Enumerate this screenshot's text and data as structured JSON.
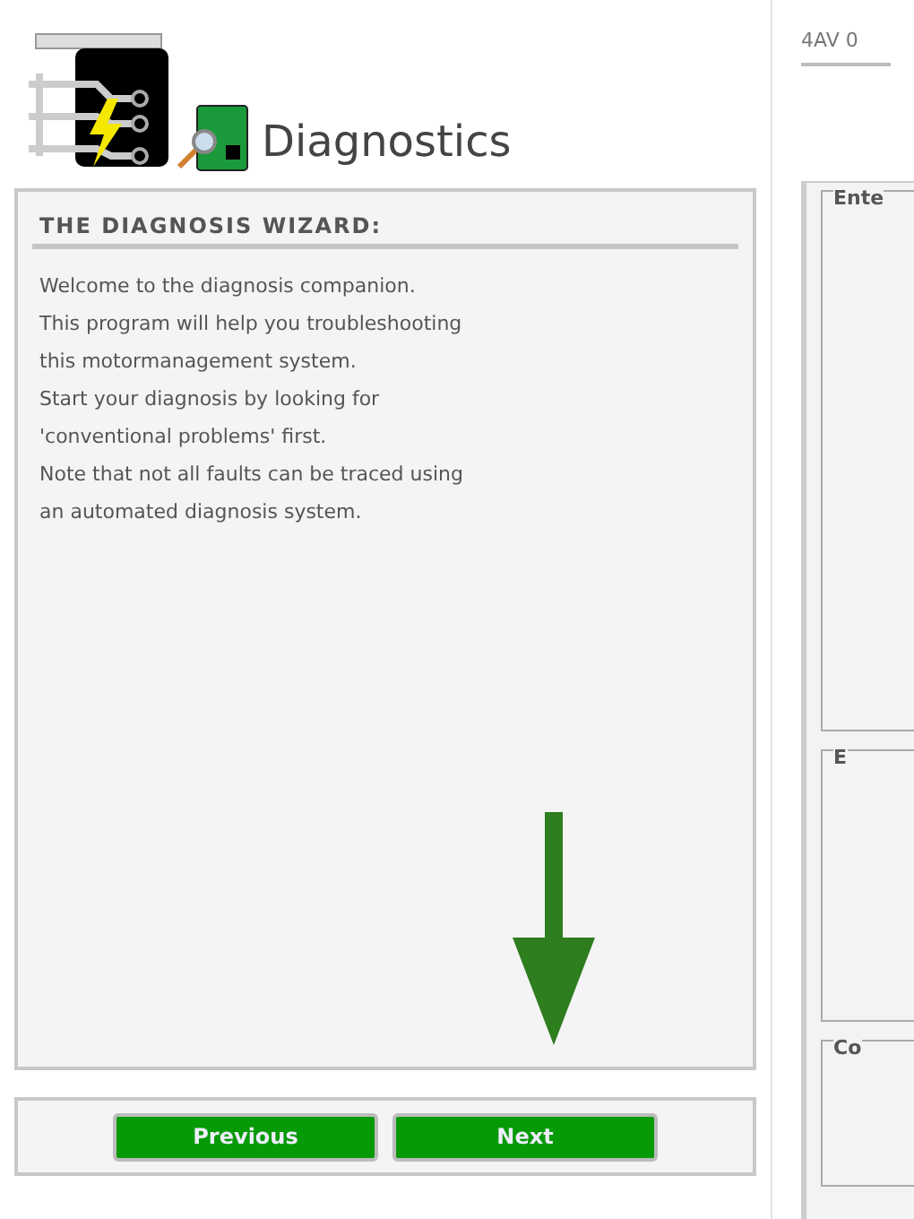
{
  "header": {
    "title": "Diagnostics"
  },
  "wizard": {
    "heading": "THE DIAGNOSIS WIZARD:",
    "lines": [
      "Welcome to the diagnosis companion.",
      "This program will help you troubleshooting",
      "this motormanagement system.",
      "Start your diagnosis by looking for",
      "'conventional problems' first.",
      "Note that not all faults can be traced using",
      "an automated diagnosis system."
    ]
  },
  "buttons": [
    "Previous",
    "Next"
  ],
  "right_panel": {
    "code": "4AV 0",
    "groups": [
      "Ente",
      "E",
      "Co"
    ]
  }
}
